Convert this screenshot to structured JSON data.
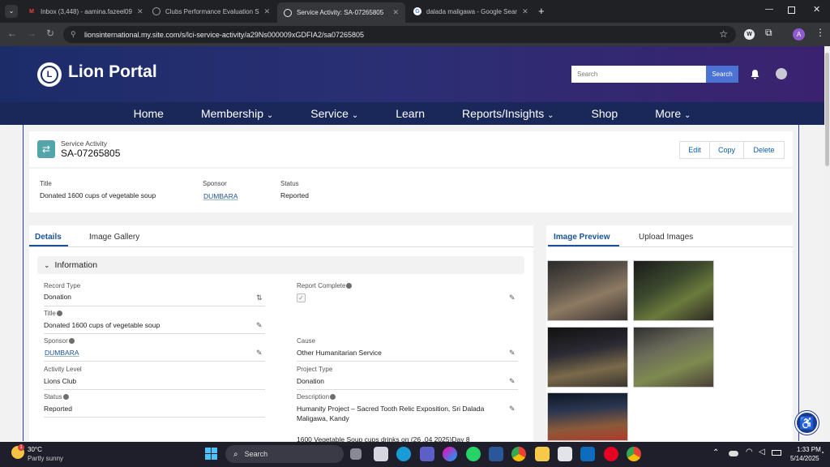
{
  "browser": {
    "tabs": [
      {
        "label": "Inbox (3,448) - aamina.fazeel09"
      },
      {
        "label": "Clubs Performance Evaluation S"
      },
      {
        "label": "Service Activity: SA-07265805"
      },
      {
        "label": "dalada maligawa - Google Sear"
      }
    ],
    "url": "lionsinternational.my.site.com/s/lci-service-activity/a29Ns000009xGDFIA2/sa07265805",
    "profile_initial": "A"
  },
  "portal": {
    "logo_text": "Lion Portal",
    "search_placeholder": "Search",
    "search_button": "Search",
    "nav": [
      "Home",
      "Membership",
      "Service",
      "Learn",
      "Reports/Insights",
      "Shop",
      "More"
    ]
  },
  "record": {
    "type_label": "Service Activity",
    "number": "SA-07265805",
    "actions": [
      "Edit",
      "Copy",
      "Delete"
    ],
    "highlights": {
      "title_label": "Title",
      "title_value": "Donated 1600 cups of vegetable soup",
      "sponsor_label": "Sponsor",
      "sponsor_value": "DUMBARA",
      "status_label": "Status",
      "status_value": "Reported"
    }
  },
  "left_tabs": [
    "Details",
    "Image Gallery"
  ],
  "right_tabs": [
    "Image Preview",
    "Upload Images"
  ],
  "section_title": "Information",
  "fields": {
    "record_type_label": "Record Type",
    "record_type_value": "Donation",
    "report_complete_label": "Report Complete",
    "title_label": "Title",
    "title_value": "Donated 1600 cups of vegetable soup",
    "sponsor_label": "Sponsor",
    "sponsor_value": "DUMBARA",
    "cause_label": "Cause",
    "cause_value": "Other Humanitarian Service",
    "activity_level_label": "Activity Level",
    "activity_level_value": "Lions Club",
    "project_type_label": "Project Type",
    "project_type_value": "Donation",
    "status_label": "Status",
    "status_value": "Reported",
    "description_label": "Description",
    "description_line1": "Humanity Project – Sacred Tooth Relic Exposition, Sri Dalada",
    "description_line2": "Maligawa, Kandy",
    "description_line3": "1600 Vegetable Soup cups drinks on (26 .04 2025)Day 8"
  },
  "taskbar": {
    "temp": "30°C",
    "weather": "Partly sunny",
    "search_label": "Search",
    "time": "1:33 PM",
    "date": "5/14/2025"
  }
}
